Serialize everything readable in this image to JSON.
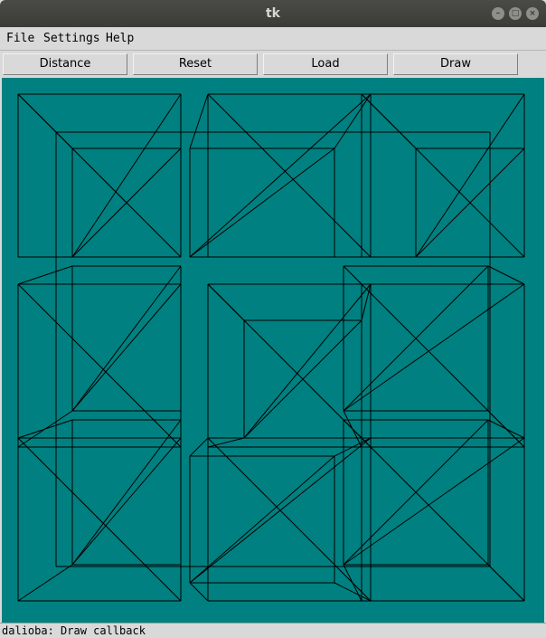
{
  "window": {
    "title": "tk"
  },
  "menu": {
    "items": [
      "File",
      "Settings",
      "Help"
    ]
  },
  "toolbar": {
    "buttons": [
      "Distance",
      "Reset",
      "Load",
      "Draw"
    ]
  },
  "status": {
    "text": "dalioba: Draw callback"
  },
  "canvas": {
    "background": "#008080",
    "stroke": "#000000"
  }
}
